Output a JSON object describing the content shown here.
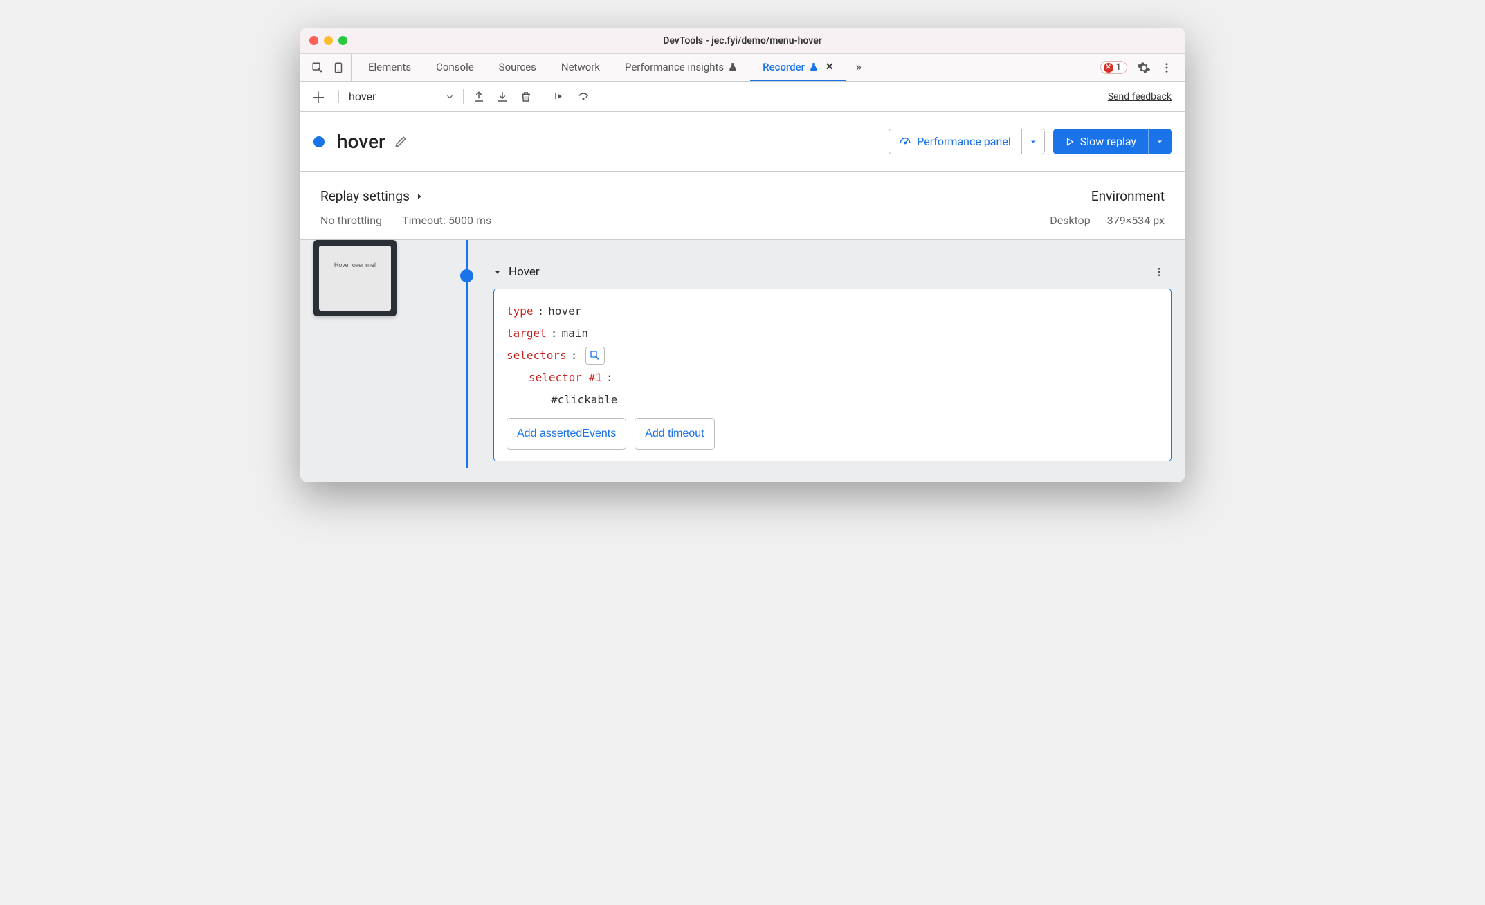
{
  "window": {
    "title": "DevTools - jec.fyi/demo/menu-hover"
  },
  "tabs": {
    "items": [
      "Elements",
      "Console",
      "Sources",
      "Network",
      "Performance insights",
      "Recorder"
    ],
    "active_index": 5,
    "errors": "1"
  },
  "toolbar": {
    "recording_select": "hover",
    "feedback_label": "Send feedback"
  },
  "header": {
    "recording_title": "hover",
    "perf_button": "Performance panel",
    "replay_button": "Slow replay"
  },
  "settings": {
    "replay_title": "Replay settings",
    "throttling": "No throttling",
    "timeout": "Timeout: 5000 ms",
    "env_title": "Environment",
    "device": "Desktop",
    "dims": "379×534 px"
  },
  "thumb": {
    "label": "Hover over me!"
  },
  "step": {
    "title": "Hover",
    "props": {
      "type_key": "type",
      "type_val": "hover",
      "target_key": "target",
      "target_val": "main",
      "selectors_key": "selectors",
      "selector1_key": "selector #1",
      "selector1_val": "#clickable"
    },
    "add_asserted": "Add assertedEvents",
    "add_timeout": "Add timeout"
  }
}
